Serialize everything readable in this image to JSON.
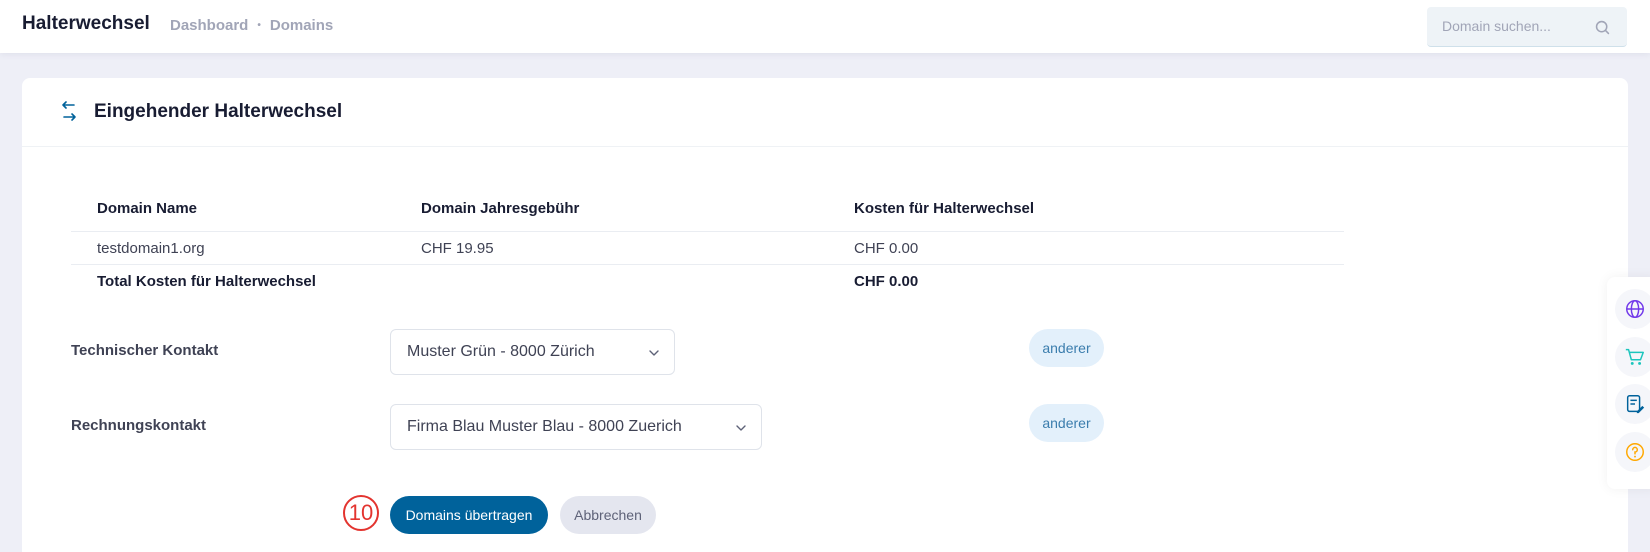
{
  "header": {
    "title": "Halterwechsel",
    "breadcrumb": [
      "Dashboard",
      "Domains"
    ],
    "breadcrumb_separator": "•",
    "search_placeholder": "Domain suchen..."
  },
  "card": {
    "title": "Eingehender Halterwechsel",
    "table": {
      "columns": [
        "Domain Name",
        "Domain Jahresgebühr",
        "Kosten für Halterwechsel"
      ],
      "rows": [
        [
          "testdomain1.org",
          "CHF 19.95",
          "CHF 0.00"
        ]
      ],
      "total": {
        "label": "Total Kosten für Halterwechsel",
        "value": "CHF 0.00"
      }
    },
    "form": {
      "technical": {
        "label": "Technischer Kontakt",
        "value": "Muster Grün - 8000 Zürich",
        "other_label": "anderer"
      },
      "billing": {
        "label": "Rechnungskontakt",
        "value": "Firma Blau Muster Blau - 8000 Zuerich",
        "other_label": "anderer"
      },
      "submit_label": "Domains übertragen",
      "cancel_label": "Abbrechen",
      "step_number": "10"
    }
  },
  "side_dock": {
    "icons": [
      "globe-icon",
      "cart-icon",
      "edit-document-icon",
      "help-icon"
    ]
  },
  "colors": {
    "primary": "#00629b",
    "pill_bg": "#e3f0fb",
    "pill_text": "#3b7dad",
    "step_badge": "#e3342f"
  }
}
